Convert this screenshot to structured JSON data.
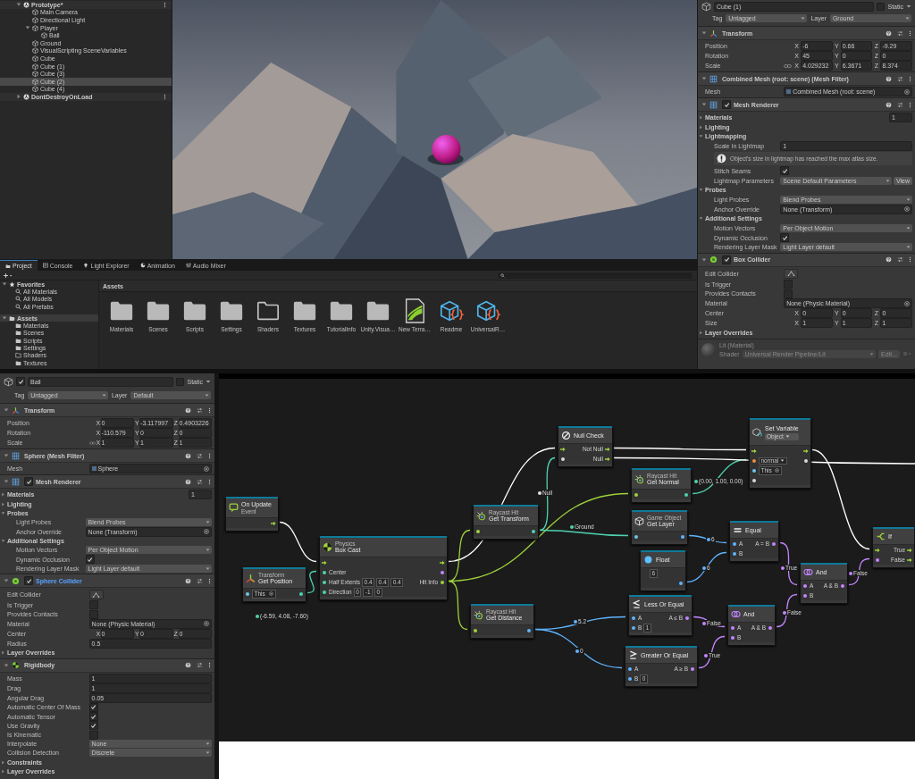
{
  "hierarchy": {
    "items": [
      {
        "label": "Prototype*",
        "kind": "scene",
        "expanded": true,
        "selected": false,
        "children": [
          {
            "label": "Main Camera",
            "kind": "object",
            "selected": false
          },
          {
            "label": "Directional Light",
            "kind": "object",
            "selected": false
          },
          {
            "label": "Player",
            "kind": "object",
            "expanded": true,
            "selected": false,
            "children": [
              {
                "label": "Ball",
                "kind": "object",
                "selected": false
              }
            ]
          },
          {
            "label": "Ground",
            "kind": "object",
            "selected": false
          },
          {
            "label": "VisualScripting SceneVariables",
            "kind": "object",
            "selected": false
          },
          {
            "label": "Cube",
            "kind": "object",
            "selected": false
          },
          {
            "label": "Cube (1)",
            "kind": "object",
            "selected": false
          },
          {
            "label": "Cube (3)",
            "kind": "object",
            "selected": false
          },
          {
            "label": "Cube (2)",
            "kind": "object",
            "selected": true
          },
          {
            "label": "Cube (4)",
            "kind": "object",
            "selected": false
          }
        ]
      },
      {
        "label": "DontDestroyOnLoad",
        "kind": "scene",
        "expanded": false,
        "selected": false
      }
    ]
  },
  "inspectors": [
    {
      "name": "Cube (1)",
      "static": {
        "label": "Static",
        "checked": false
      },
      "tag": {
        "label": "Tag",
        "value": "Untagged"
      },
      "layer": {
        "label": "Layer",
        "value": "Ground"
      },
      "components": [
        {
          "title": "Transform",
          "kind": "transform",
          "highlighted": false,
          "rows": [
            {
              "kind": "vector",
              "label": "Position",
              "linked": false,
              "values": [
                {
                  "axis": "X",
                  "value": "-6"
                },
                {
                  "axis": "Y",
                  "value": "0.66"
                },
                {
                  "axis": "Z",
                  "value": "-9.29"
                }
              ]
            },
            {
              "kind": "vector",
              "label": "Rotation",
              "linked": false,
              "values": [
                {
                  "axis": "X",
                  "value": "45"
                },
                {
                  "axis": "Y",
                  "value": "0"
                },
                {
                  "axis": "Z",
                  "value": "0"
                }
              ]
            },
            {
              "kind": "vector",
              "label": "Scale",
              "linked": true,
              "values": [
                {
                  "axis": "X",
                  "value": "4.029232"
                },
                {
                  "axis": "Y",
                  "value": "6.3671"
                },
                {
                  "axis": "Z",
                  "value": "8.374"
                }
              ]
            }
          ]
        },
        {
          "title": "Combined Mesh (root: scene) (Mesh Filter)",
          "kind": "mesh-filter",
          "highlighted": false,
          "rows": [
            {
              "kind": "mesh",
              "label": "Mesh",
              "value": "Combined Mesh (root: scene)"
            }
          ]
        },
        {
          "title": "Mesh Renderer",
          "kind": "mesh-renderer",
          "enabled": true,
          "highlighted": false,
          "rows": [
            {
              "kind": "foldout",
              "label": "Materials",
              "expanded": false,
              "value": "1"
            },
            {
              "kind": "foldout",
              "label": "Lighting",
              "expanded": false
            },
            {
              "kind": "foldout",
              "label": "Lightmapping",
              "expanded": true,
              "children": [
                {
                  "kind": "field",
                  "label": "Scale In Lightmap",
                  "value": "1"
                },
                {
                  "kind": "help",
                  "text": "Object's size in lightmap has reached the max atlas size."
                },
                {
                  "kind": "check",
                  "label": "Stitch Seams",
                  "checked": true
                },
                {
                  "kind": "dropdown",
                  "label": "Lightmap Parameters",
                  "value": "Scene Default Parameters",
                  "button": "View"
                }
              ]
            },
            {
              "kind": "foldout",
              "label": "Probes",
              "expanded": true,
              "children": [
                {
                  "kind": "dropdown",
                  "label": "Light Probes",
                  "value": "Blend Probes"
                },
                {
                  "kind": "object",
                  "label": "Anchor Override",
                  "value": "None (Transform)"
                }
              ]
            },
            {
              "kind": "foldout",
              "label": "Additional Settings",
              "expanded": true,
              "children": [
                {
                  "kind": "dropdown",
                  "label": "Motion Vectors",
                  "value": "Per Object Motion"
                },
                {
                  "kind": "check",
                  "label": "Dynamic Occlusion",
                  "checked": true
                },
                {
                  "kind": "dropdown",
                  "label": "Rendering Layer Mask",
                  "value": "Light Layer default"
                }
              ]
            }
          ]
        },
        {
          "title": "Box Collider",
          "kind": "collider",
          "enabled": true,
          "highlighted": false,
          "rows": [
            {
              "kind": "edit",
              "label": "Edit Collider"
            },
            {
              "kind": "check",
              "label": "Is Trigger",
              "checked": false
            },
            {
              "kind": "check",
              "label": "Provides Contacts",
              "checked": false
            },
            {
              "kind": "object",
              "label": "Material",
              "value": "None (Physic Material)"
            },
            {
              "kind": "vector",
              "label": "Center",
              "linked": false,
              "values": [
                {
                  "axis": "X",
                  "value": "0"
                },
                {
                  "axis": "Y",
                  "value": "0"
                },
                {
                  "axis": "Z",
                  "value": "0"
                }
              ]
            },
            {
              "kind": "vector",
              "label": "Size",
              "linked": false,
              "values": [
                {
                  "axis": "X",
                  "value": "1"
                },
                {
                  "axis": "Y",
                  "value": "1"
                },
                {
                  "axis": "Z",
                  "value": "1"
                }
              ]
            },
            {
              "kind": "foldout",
              "label": "Layer Overrides",
              "expanded": false
            }
          ]
        }
      ],
      "material": {
        "title": "Lit (Material)",
        "shader_label": "Shader",
        "shader": "Universal Render Pipeline/Lit",
        "button": "Edit..."
      }
    },
    {
      "name": "Ball",
      "active": true,
      "static": {
        "label": "Static",
        "checked": false
      },
      "tag": {
        "label": "Tag",
        "value": "Untagged"
      },
      "layer": {
        "label": "Layer",
        "value": "Default"
      },
      "components": [
        {
          "title": "Transform",
          "kind": "transform",
          "highlighted": false,
          "rows": [
            {
              "kind": "vector",
              "label": "Position",
              "linked": false,
              "values": [
                {
                  "axis": "X",
                  "value": "0"
                },
                {
                  "axis": "Y",
                  "value": "-3.117997"
                },
                {
                  "axis": "Z",
                  "value": "0.4903226"
                }
              ]
            },
            {
              "kind": "vector",
              "label": "Rotation",
              "linked": false,
              "values": [
                {
                  "axis": "X",
                  "value": "-110.579"
                },
                {
                  "axis": "Y",
                  "value": "0"
                },
                {
                  "axis": "Z",
                  "value": "0"
                }
              ]
            },
            {
              "kind": "vector",
              "label": "Scale",
              "linked": true,
              "values": [
                {
                  "axis": "X",
                  "value": "1"
                },
                {
                  "axis": "Y",
                  "value": "1"
                },
                {
                  "axis": "Z",
                  "value": "1"
                }
              ]
            }
          ]
        },
        {
          "title": "Sphere (Mesh Filter)",
          "kind": "mesh-filter",
          "highlighted": false,
          "rows": [
            {
              "kind": "mesh",
              "label": "Mesh",
              "value": "Sphere"
            }
          ]
        },
        {
          "title": "Mesh Renderer",
          "kind": "mesh-renderer",
          "enabled": true,
          "highlighted": false,
          "rows": [
            {
              "kind": "foldout",
              "label": "Materials",
              "expanded": false,
              "value": "1"
            },
            {
              "kind": "foldout",
              "label": "Lighting",
              "expanded": false
            },
            {
              "kind": "foldout",
              "label": "Probes",
              "expanded": true,
              "children": [
                {
                  "kind": "dropdown",
                  "label": "Light Probes",
                  "value": "Blend Probes"
                },
                {
                  "kind": "object",
                  "label": "Anchor Override",
                  "value": "None (Transform)"
                }
              ]
            },
            {
              "kind": "foldout",
              "label": "Additional Settings",
              "expanded": true,
              "children": [
                {
                  "kind": "dropdown",
                  "label": "Motion Vectors",
                  "value": "Per Object Motion"
                },
                {
                  "kind": "check",
                  "label": "Dynamic Occlusion",
                  "checked": true
                },
                {
                  "kind": "dropdown",
                  "label": "Rendering Layer Mask",
                  "value": "Light Layer default"
                }
              ]
            }
          ]
        },
        {
          "title": "Sphere Collider",
          "kind": "collider",
          "enabled": true,
          "highlighted": true,
          "rows": [
            {
              "kind": "edit",
              "label": "Edit Collider"
            },
            {
              "kind": "check",
              "label": "Is Trigger",
              "checked": false
            },
            {
              "kind": "check",
              "label": "Provides Contacts",
              "checked": false
            },
            {
              "kind": "object",
              "label": "Material",
              "value": "None (Physic Material)"
            },
            {
              "kind": "vector",
              "label": "Center",
              "linked": false,
              "values": [
                {
                  "axis": "X",
                  "value": "0"
                },
                {
                  "axis": "Y",
                  "value": "0"
                },
                {
                  "axis": "Z",
                  "value": "0"
                }
              ]
            },
            {
              "kind": "field",
              "label": "Radius",
              "value": "0.5"
            },
            {
              "kind": "foldout",
              "label": "Layer Overrides",
              "expanded": false
            }
          ]
        },
        {
          "title": "Rigidbody",
          "kind": "rigidbody",
          "highlighted": false,
          "rows": [
            {
              "kind": "field",
              "label": "Mass",
              "value": "1"
            },
            {
              "kind": "field",
              "label": "Drag",
              "value": "1"
            },
            {
              "kind": "field",
              "label": "Angular Drag",
              "value": "0.05"
            },
            {
              "kind": "check",
              "label": "Automatic Center Of Mass",
              "checked": true
            },
            {
              "kind": "check",
              "label": "Automatic Tensor",
              "checked": true
            },
            {
              "kind": "check",
              "label": "Use Gravity",
              "checked": true
            },
            {
              "kind": "check",
              "label": "Is Kinematic",
              "checked": false
            },
            {
              "kind": "dropdown",
              "label": "Interpolate",
              "value": "None"
            },
            {
              "kind": "dropdown",
              "label": "Collision Detection",
              "value": "Discrete"
            },
            {
              "kind": "foldout",
              "label": "Constraints",
              "expanded": false
            },
            {
              "kind": "foldout",
              "label": "Layer Overrides",
              "expanded": false
            }
          ]
        }
      ]
    }
  ],
  "project": {
    "tabs": [
      {
        "label": "Project",
        "kind": "project",
        "selected": true
      },
      {
        "label": "Console",
        "kind": "console",
        "selected": false
      },
      {
        "label": "Light Explorer",
        "kind": "light",
        "selected": false
      },
      {
        "label": "Animation",
        "kind": "animation",
        "selected": false
      },
      {
        "label": "Audio Mixer",
        "kind": "mixer",
        "selected": false
      }
    ],
    "tree": [
      {
        "label": "Favorites",
        "kind": "favorites",
        "expanded": true,
        "selected": false,
        "children": [
          {
            "label": "All Materials",
            "kind": "search",
            "selected": false
          },
          {
            "label": "All Models",
            "kind": "search",
            "selected": false
          },
          {
            "label": "All Prefabs",
            "kind": "search",
            "selected": false
          }
        ]
      },
      {
        "label": "Assets",
        "kind": "open-folder",
        "expanded": true,
        "selected": true,
        "children": [
          {
            "label": "Materials",
            "kind": "folder",
            "selected": false
          },
          {
            "label": "Scenes",
            "kind": "folder",
            "selected": false
          },
          {
            "label": "Scripts",
            "kind": "folder",
            "selected": false
          },
          {
            "label": "Settings",
            "kind": "folder",
            "selected": false
          },
          {
            "label": "Shaders",
            "kind": "empty-folder",
            "selected": false
          },
          {
            "label": "Textures",
            "kind": "folder",
            "selected": false
          }
        ]
      }
    ],
    "breadcrumb": "Assets",
    "assets": [
      {
        "label": "Materials",
        "kind": "folder",
        "selected": false
      },
      {
        "label": "Scenes",
        "kind": "folder",
        "selected": false
      },
      {
        "label": "Scripts",
        "kind": "folder",
        "selected": false
      },
      {
        "label": "Settings",
        "kind": "folder",
        "selected": false
      },
      {
        "label": "Shaders",
        "kind": "empty-folder",
        "selected": false
      },
      {
        "label": "Textures",
        "kind": "folder",
        "selected": false
      },
      {
        "label": "TutorialInfo",
        "kind": "folder",
        "selected": false
      },
      {
        "label": "Unity.Visua…",
        "kind": "folder",
        "selected": false
      },
      {
        "label": "New Terra…",
        "kind": "terrain",
        "selected": false
      },
      {
        "label": "Readme",
        "kind": "script-asset",
        "selected": false
      },
      {
        "label": "UniversalR…",
        "kind": "script-asset",
        "selected": false
      }
    ]
  },
  "graph": {
    "nodes": [
      {
        "kind": "event",
        "title": "On Update",
        "caption": "Event",
        "rows": [
          {
            "out": {
              "kind": "flow"
            }
          }
        ]
      },
      {
        "kind": "transform",
        "category": "Transform",
        "title": "Get Position",
        "rows": [
          {
            "in": {
              "kind": "object"
            },
            "fields": [
              {
                "kind": "object",
                "value": "This"
              }
            ],
            "out": {
              "kind": "vector"
            }
          }
        ]
      },
      {
        "kind": "physics",
        "category": "Physics",
        "title": "Box Cast",
        "rows": [
          {
            "in": {
              "kind": "flow"
            },
            "out": {
              "kind": "flow"
            }
          },
          {
            "in": {
              "kind": "vector"
            },
            "left": "Center",
            "out": {
              "kind": "bool"
            }
          },
          {
            "in": {
              "kind": "vector"
            },
            "left": "Half Extents",
            "fields": [
              {
                "kind": "text",
                "value": "0.4"
              },
              {
                "kind": "text",
                "value": "0.4"
              },
              {
                "kind": "text",
                "value": "0.4"
              }
            ],
            "right": "Hit Info",
            "out": {
              "kind": "hit"
            }
          },
          {
            "in": {
              "kind": "vector"
            },
            "left": "Direction",
            "fields": [
              {
                "kind": "text",
                "value": "0"
              },
              {
                "kind": "text",
                "value": "-1"
              },
              {
                "kind": "text",
                "value": "0"
              }
            ]
          }
        ]
      },
      {
        "kind": "raycast",
        "category": "Raycast Hit",
        "title": "Get Transform",
        "rows": [
          {
            "in": {
              "kind": "hit"
            },
            "out": {
              "kind": "vector"
            }
          }
        ]
      },
      {
        "kind": "null-check",
        "title": "Null Check",
        "rows": [
          {
            "in": {
              "kind": "flow"
            },
            "right": "Not Null",
            "out": {
              "kind": "flow"
            }
          },
          {
            "in": {
              "kind": "any"
            },
            "right": "Null",
            "out": {
              "kind": "flow"
            }
          }
        ]
      },
      {
        "kind": "raycast",
        "category": "Raycast Hit",
        "title": "Get Normal",
        "rows": [
          {
            "in": {
              "kind": "hit"
            },
            "out": {
              "kind": "vector"
            }
          }
        ]
      },
      {
        "kind": "gameobject",
        "category": "Game Object",
        "title": "Get Layer",
        "rows": [
          {
            "in": {
              "kind": "object"
            },
            "out": {
              "kind": "number"
            }
          }
        ]
      },
      {
        "kind": "float",
        "title": "Float",
        "rows": [
          {
            "fields": [
              {
                "kind": "text",
                "value": "6"
              }
            ]
          },
          {
            "out": {
              "kind": "number"
            }
          }
        ]
      },
      {
        "kind": "equal",
        "title": "Equal",
        "rows": [
          {
            "in": {
              "kind": "number"
            },
            "left": "A",
            "right": "A = B",
            "out": {
              "kind": "bool"
            }
          },
          {
            "in": {
              "kind": "number"
            },
            "left": "B"
          }
        ]
      },
      {
        "kind": "set-variable",
        "title": "Set Variable",
        "selector": "Object",
        "rows": [
          {
            "in": {
              "kind": "flow"
            },
            "out": {
              "kind": "flow"
            }
          },
          {
            "in": {
              "kind": "string"
            },
            "fields": [
              {
                "kind": "dropdown",
                "value": "normal"
              }
            ],
            "out": {
              "kind": "any"
            }
          },
          {
            "in": {
              "kind": "object"
            },
            "fields": [
              {
                "kind": "object",
                "value": "This"
              }
            ]
          },
          {
            "in": {
              "kind": "any"
            }
          }
        ]
      },
      {
        "kind": "raycast",
        "category": "Raycast Hit",
        "title": "Get Distance",
        "rows": [
          {
            "in": {
              "kind": "hit"
            },
            "out": {
              "kind": "number"
            }
          }
        ]
      },
      {
        "kind": "less-equal",
        "title": "Less Or Equal",
        "rows": [
          {
            "in": {
              "kind": "number"
            },
            "left": "A",
            "right": "A ≤ B",
            "out": {
              "kind": "bool"
            }
          },
          {
            "in": {
              "kind": "number"
            },
            "left": "B",
            "fields": [
              {
                "kind": "text",
                "value": "1"
              }
            ]
          }
        ]
      },
      {
        "kind": "greater-equal",
        "title": "Greater Or Equal",
        "rows": [
          {
            "in": {
              "kind": "number"
            },
            "left": "A",
            "right": "A ≥ B",
            "out": {
              "kind": "bool"
            }
          },
          {
            "in": {
              "kind": "number"
            },
            "left": "B",
            "fields": [
              {
                "kind": "text",
                "value": "0"
              }
            ]
          }
        ]
      },
      {
        "kind": "and",
        "title": "And",
        "rows": [
          {
            "in": {
              "kind": "bool"
            },
            "left": "A",
            "right": "A & B",
            "out": {
              "kind": "bool"
            }
          },
          {
            "in": {
              "kind": "bool"
            },
            "left": "B"
          }
        ]
      },
      {
        "kind": "and",
        "title": "And",
        "rows": [
          {
            "in": {
              "kind": "bool"
            },
            "left": "A",
            "right": "A & B",
            "out": {
              "kind": "bool"
            }
          },
          {
            "in": {
              "kind": "bool"
            },
            "left": "B"
          }
        ]
      },
      {
        "kind": "if",
        "title": "If",
        "rows": [
          {
            "in": {
              "kind": "flow"
            },
            "right": "True",
            "out": {
              "kind": "flow"
            }
          },
          {
            "in": {
              "kind": "bool"
            },
            "right": "False",
            "out": {
              "kind": "flow"
            }
          }
        ]
      }
    ],
    "wire_labels": [
      {
        "text": "(-6.59, 4.08, -7.60)",
        "kind": "vector"
      },
      {
        "text": "Null",
        "kind": "null"
      },
      {
        "text": "Ground",
        "kind": "vector"
      },
      {
        "text": "(0.00, 1.00, 0.00)",
        "kind": "vector"
      },
      {
        "text": "6",
        "kind": "number"
      },
      {
        "text": "6",
        "kind": "number"
      },
      {
        "text": "5.2",
        "kind": "number"
      },
      {
        "text": "0",
        "kind": "number"
      },
      {
        "text": "True",
        "kind": "bool"
      },
      {
        "text": "False",
        "kind": "bool"
      },
      {
        "text": "True",
        "kind": "bool"
      },
      {
        "text": "False",
        "kind": "bool"
      },
      {
        "text": "False",
        "kind": "bool"
      }
    ]
  }
}
